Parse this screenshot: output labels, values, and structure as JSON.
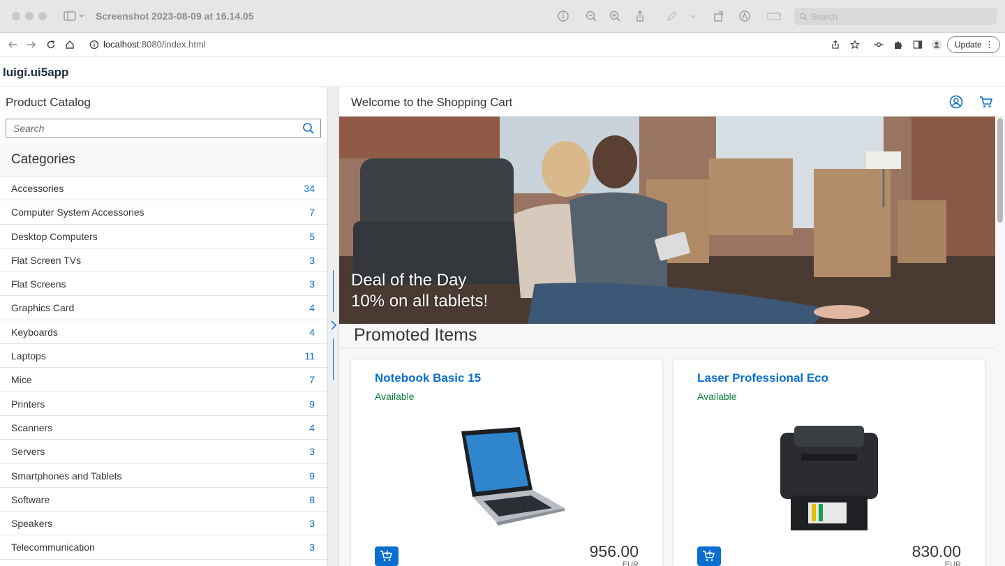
{
  "window": {
    "title": "Screenshot 2023-08-09 at 16.14.05",
    "search_placeholder": "Search"
  },
  "browser": {
    "url_host": "localhost",
    "url_rest": ":8080/index.html",
    "update_label": "Update"
  },
  "app": {
    "title": "luigi.ui5app"
  },
  "master": {
    "title": "Product Catalog",
    "search_placeholder": "Search",
    "categories_title": "Categories",
    "categories": [
      {
        "label": "Accessories",
        "count": "34"
      },
      {
        "label": "Computer System Accessories",
        "count": "7"
      },
      {
        "label": "Desktop Computers",
        "count": "5"
      },
      {
        "label": "Flat Screen TVs",
        "count": "3"
      },
      {
        "label": "Flat Screens",
        "count": "3"
      },
      {
        "label": "Graphics Card",
        "count": "4"
      },
      {
        "label": "Keyboards",
        "count": "4"
      },
      {
        "label": "Laptops",
        "count": "11"
      },
      {
        "label": "Mice",
        "count": "7"
      },
      {
        "label": "Printers",
        "count": "9"
      },
      {
        "label": "Scanners",
        "count": "4"
      },
      {
        "label": "Servers",
        "count": "3"
      },
      {
        "label": "Smartphones and Tablets",
        "count": "9"
      },
      {
        "label": "Software",
        "count": "8"
      },
      {
        "label": "Speakers",
        "count": "3"
      },
      {
        "label": "Telecommunication",
        "count": "3"
      }
    ]
  },
  "detail": {
    "title": "Welcome to the Shopping Cart",
    "hero_line1": "Deal of the Day",
    "hero_line2": "10% on all tablets!",
    "promoted_title": "Promoted Items",
    "products": [
      {
        "name": "Notebook Basic 15",
        "status": "Available",
        "price": "956.00",
        "currency": "EUR"
      },
      {
        "name": "Laser Professional Eco",
        "status": "Available",
        "price": "830.00",
        "currency": "EUR"
      }
    ]
  },
  "colors": {
    "accent": "#0a6ed1",
    "success": "#107e3e",
    "text": "#32363a"
  }
}
